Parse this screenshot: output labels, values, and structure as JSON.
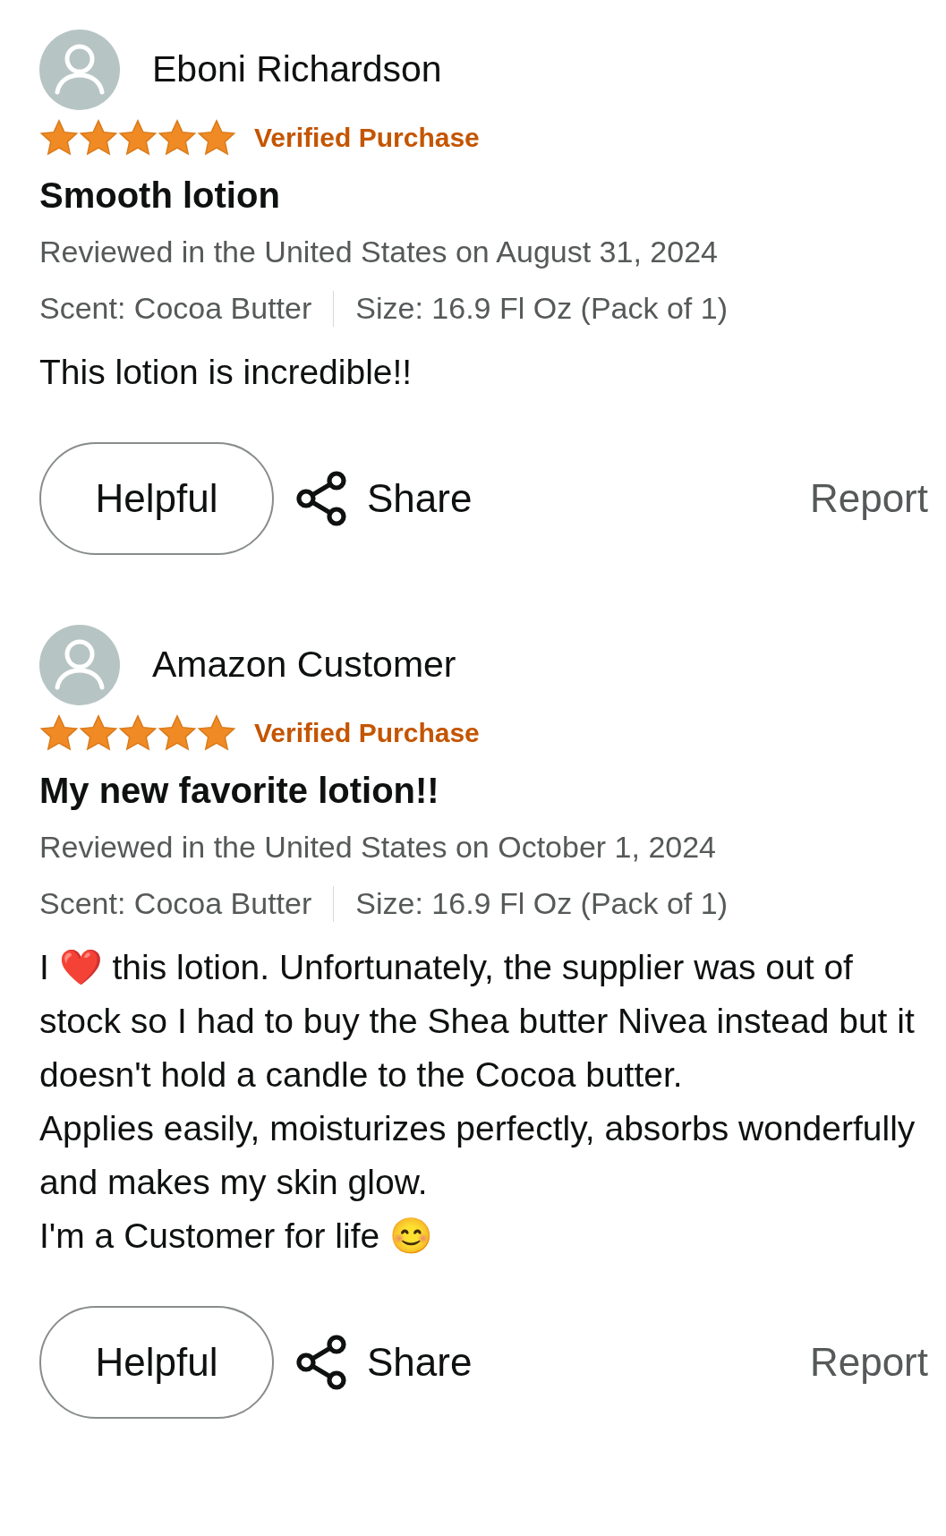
{
  "reviews": [
    {
      "author": "Eboni Richardson",
      "stars": 5,
      "badge": "Verified Purchase",
      "title": "Smooth lotion",
      "date": "Reviewed in the United States on August 31, 2024",
      "variant_scent": "Scent: Cocoa Butter",
      "variant_size": "Size: 16.9 Fl Oz (Pack of 1)",
      "body": [
        "This lotion is incredible!!"
      ],
      "helpful": "Helpful",
      "share": "Share",
      "report": "Report"
    },
    {
      "author": "Amazon Customer",
      "stars": 5,
      "badge": "Verified Purchase",
      "title": "My new favorite lotion!!",
      "date": "Reviewed in the United States on October 1, 2024",
      "variant_scent": "Scent: Cocoa Butter",
      "variant_size": "Size: 16.9 Fl Oz (Pack of 1)",
      "body": [
        "I ❤️ this lotion. Unfortunately, the supplier was out of stock so I had to buy the Shea butter Nivea instead but it doesn't hold a candle to the Cocoa butter.",
        "Applies easily, moisturizes perfectly, absorbs wonderfully and makes my skin glow.",
        "I'm a Customer for life 😊"
      ],
      "helpful": "Helpful",
      "share": "Share",
      "report": "Report"
    }
  ]
}
